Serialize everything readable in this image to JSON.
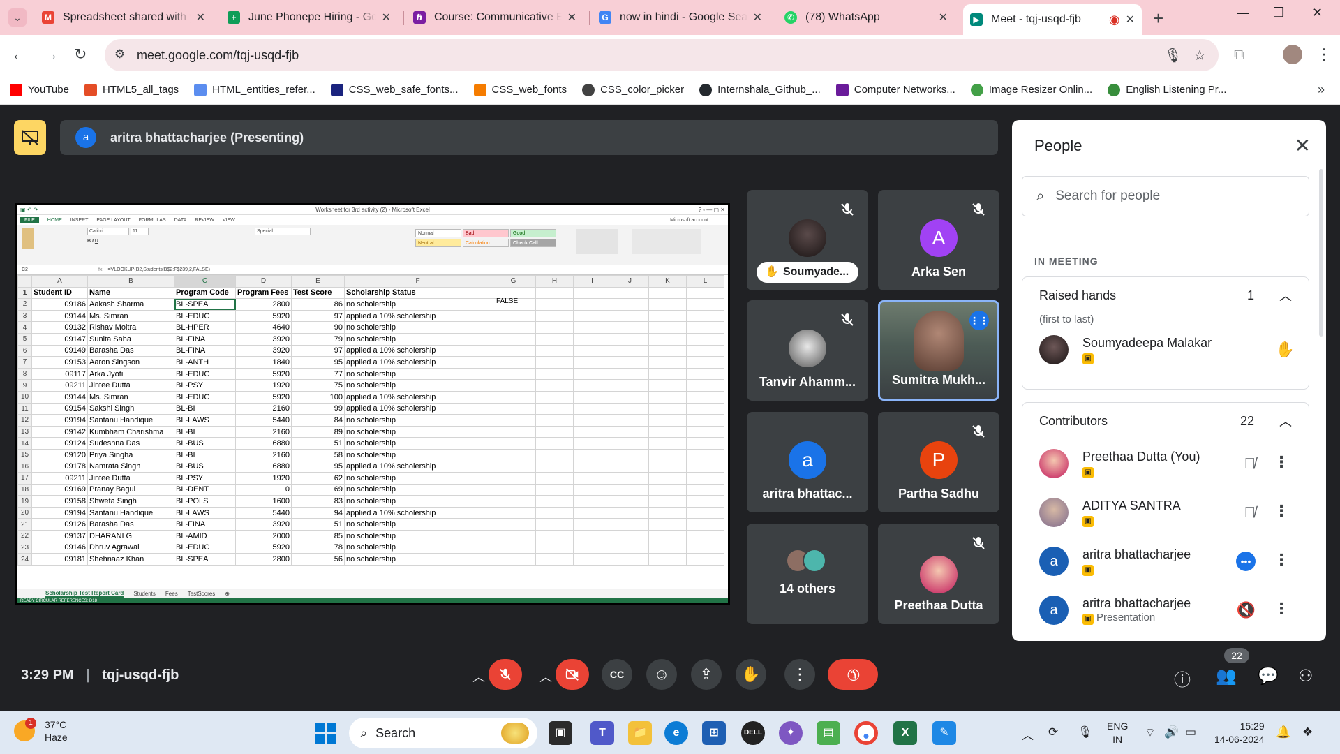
{
  "browser": {
    "tabs": [
      {
        "title": "Spreadsheet shared with y",
        "icon": "gmail-icon",
        "color": "#ea4335"
      },
      {
        "title": "June Phonepe Hiring - Goo",
        "icon": "sheets-icon",
        "color": "#0f9d58"
      },
      {
        "title": "Course: Communicative En",
        "icon": "course-icon",
        "color": "#7b1fa2"
      },
      {
        "title": "now in hindi - Google Sear",
        "icon": "google-icon",
        "color": "#4285f4"
      },
      {
        "title": "(78) WhatsApp",
        "icon": "whatsapp-icon",
        "color": "#25d366"
      },
      {
        "title": "Meet - tqj-usqd-fjb",
        "icon": "meet-icon",
        "color": "#00897b",
        "active": true
      }
    ],
    "url": "meet.google.com/tqj-usqd-fjb",
    "bookmarks": [
      {
        "label": "YouTube",
        "color": "#ff0000"
      },
      {
        "label": "HTML5_all_tags",
        "color": "#e44d26"
      },
      {
        "label": "HTML_entities_refer...",
        "color": "#5b8def"
      },
      {
        "label": "CSS_web_safe_fonts...",
        "color": "#1a237e"
      },
      {
        "label": "CSS_web_fonts",
        "color": "#f57c00"
      },
      {
        "label": "CSS_color_picker",
        "color": "#424242"
      },
      {
        "label": "Internshala_Github_...",
        "color": "#24292e"
      },
      {
        "label": "Computer Networks...",
        "color": "#6a1b9a"
      },
      {
        "label": "Image Resizer Onlin...",
        "color": "#43a047"
      },
      {
        "label": "English Listening Pr...",
        "color": "#388e3c"
      }
    ]
  },
  "meet": {
    "presenter_initial": "a",
    "presenter_text": "aritra bhattacharjee (Presenting)",
    "time": "3:29 PM",
    "meeting_code": "tqj-usqd-fjb",
    "people_count": "22"
  },
  "excel": {
    "title": "Worksheet for 3rd activity (2) - Microsoft Excel",
    "ribbon_tabs": [
      "FILE",
      "HOME",
      "INSERT",
      "PAGE LAYOUT",
      "FORMULAS",
      "DATA",
      "REVIEW",
      "VIEW"
    ],
    "account": "Microsoft account",
    "font": "Calibri",
    "font_size": "11",
    "styles": [
      {
        "label": "Normal",
        "bg": "#ffffff"
      },
      {
        "label": "Bad",
        "bg": "#ffc7ce"
      },
      {
        "label": "Good",
        "bg": "#c6efce"
      },
      {
        "label": "Neutral",
        "bg": "#ffeb9c"
      },
      {
        "label": "Calculation",
        "bg": "#f2f2f2"
      },
      {
        "label": "Check Cell",
        "bg": "#a5a5a5"
      }
    ],
    "cell_ref": "C2",
    "formula": "=VLOOKUP(B2,Students!B$2:F$239,2,FALSE)",
    "columns": [
      "A",
      "B",
      "C",
      "D",
      "E",
      "F",
      "G",
      "H",
      "I",
      "J",
      "K",
      "L"
    ],
    "headers": [
      "Student ID",
      "Name",
      "Program Code",
      "Program Fees",
      "Test Score",
      "Scholarship Status"
    ],
    "rows": [
      [
        "09186",
        "Aakash Sharma",
        "BL-SPEA",
        "2800",
        "86",
        "no scholership"
      ],
      [
        "09144",
        "Ms. Simran",
        "BL-EDUC",
        "5920",
        "97",
        "applied a 10% scholership"
      ],
      [
        "09132",
        "Rishav Moitra",
        "BL-HPER",
        "4640",
        "90",
        "no scholership"
      ],
      [
        "09147",
        "Sunita Saha",
        "BL-FINA",
        "3920",
        "79",
        "no scholership"
      ],
      [
        "09149",
        "Barasha Das",
        "BL-FINA",
        "3920",
        "97",
        "applied a 10% scholership"
      ],
      [
        "09153",
        "Aaron Singson",
        "BL-ANTH",
        "1840",
        "95",
        "applied a 10% scholership"
      ],
      [
        "09117",
        "Arka Jyoti",
        "BL-EDUC",
        "5920",
        "77",
        "no scholership"
      ],
      [
        "09211",
        "Jintee Dutta",
        "BL-PSY",
        "1920",
        "75",
        "no scholership"
      ],
      [
        "09144",
        "Ms. Simran",
        "BL-EDUC",
        "5920",
        "100",
        "applied a 10% scholership"
      ],
      [
        "09154",
        "Sakshi Singh",
        "BL-BI",
        "2160",
        "99",
        "applied a 10% scholership"
      ],
      [
        "09194",
        "Santanu Handique",
        "BL-LAWS",
        "5440",
        "84",
        "no scholership"
      ],
      [
        "09142",
        "Kumbham Charishma",
        "BL-BI",
        "2160",
        "89",
        "no scholership"
      ],
      [
        "09124",
        "Sudeshna Das",
        "BL-BUS",
        "6880",
        "51",
        "no scholership"
      ],
      [
        "09120",
        "Priya Singha",
        "BL-BI",
        "2160",
        "58",
        "no scholership"
      ],
      [
        "09178",
        "Namrata Singh",
        "BL-BUS",
        "6880",
        "95",
        "applied a 10% scholership"
      ],
      [
        "09211",
        "Jintee Dutta",
        "BL-PSY",
        "1920",
        "62",
        "no scholership"
      ],
      [
        "09169",
        "Pranay Bagul",
        "BL-DENT",
        "0",
        "69",
        "no scholership"
      ],
      [
        "09158",
        "Shweta Singh",
        "BL-POLS",
        "1600",
        "83",
        "no scholership"
      ],
      [
        "09194",
        "Santanu Handique",
        "BL-LAWS",
        "5440",
        "94",
        "applied a 10% scholership"
      ],
      [
        "09126",
        "Barasha Das",
        "BL-FINA",
        "3920",
        "51",
        "no scholership"
      ],
      [
        "09137",
        "DHARANI G",
        "BL-AMID",
        "2000",
        "85",
        "no scholership"
      ],
      [
        "09146",
        "Dhruv Agrawal",
        "BL-EDUC",
        "5920",
        "78",
        "no scholership"
      ],
      [
        "09181",
        "Shehnaaz Khan",
        "BL-SPEA",
        "2800",
        "56",
        "no scholership"
      ]
    ],
    "g2_value": "FALSE",
    "sheet_tabs": [
      "Scholarship Test Report Card",
      "Students",
      "Fees",
      "TestScores"
    ],
    "status": "READY   CIRCULAR REFERENCES: D18"
  },
  "tiles": [
    {
      "name": "Soumyade...",
      "type": "hand",
      "muted": true
    },
    {
      "name": "Arka Sen",
      "initial": "A",
      "color": "#a142f4",
      "muted": true
    },
    {
      "name": "Tanvir Ahamm...",
      "type": "photo",
      "muted": true
    },
    {
      "name": "Sumitra Mukh...",
      "type": "speaking"
    },
    {
      "name": "aritra bhattac...",
      "initial": "a",
      "color": "#1a73e8"
    },
    {
      "name": "Partha Sadhu",
      "initial": "P",
      "color": "#e8430e",
      "muted": true
    },
    {
      "name": "14 others",
      "type": "others"
    },
    {
      "name": "Preethaa Dutta",
      "type": "photo",
      "muted": true
    }
  ],
  "people_panel": {
    "title": "People",
    "search_placeholder": "Search for people",
    "section": "IN MEETING",
    "raised_hands": {
      "label": "Raised hands",
      "count": "1",
      "order_note": "(first to last)",
      "person": "Soumyadeepa Malakar"
    },
    "contributors": {
      "label": "Contributors",
      "count": "22",
      "people": [
        {
          "name": "Preethaa Dutta (You)",
          "sub": "",
          "action": "mic-off-icon"
        },
        {
          "name": "ADITYA SANTRA",
          "sub": "",
          "action": "mic-off-icon"
        },
        {
          "name": "aritra bhattacharjee",
          "sub": "",
          "action": "speaking-icon"
        },
        {
          "name": "aritra bhattacharjee",
          "sub": "Presentation",
          "action": "volume-off-icon"
        }
      ]
    }
  },
  "taskbar": {
    "temperature": "37°C",
    "weather": "Haze",
    "weather_badge": "1",
    "search": "Search",
    "lang_top": "ENG",
    "lang_bottom": "IN",
    "time": "15:29",
    "date": "14-06-2024"
  }
}
